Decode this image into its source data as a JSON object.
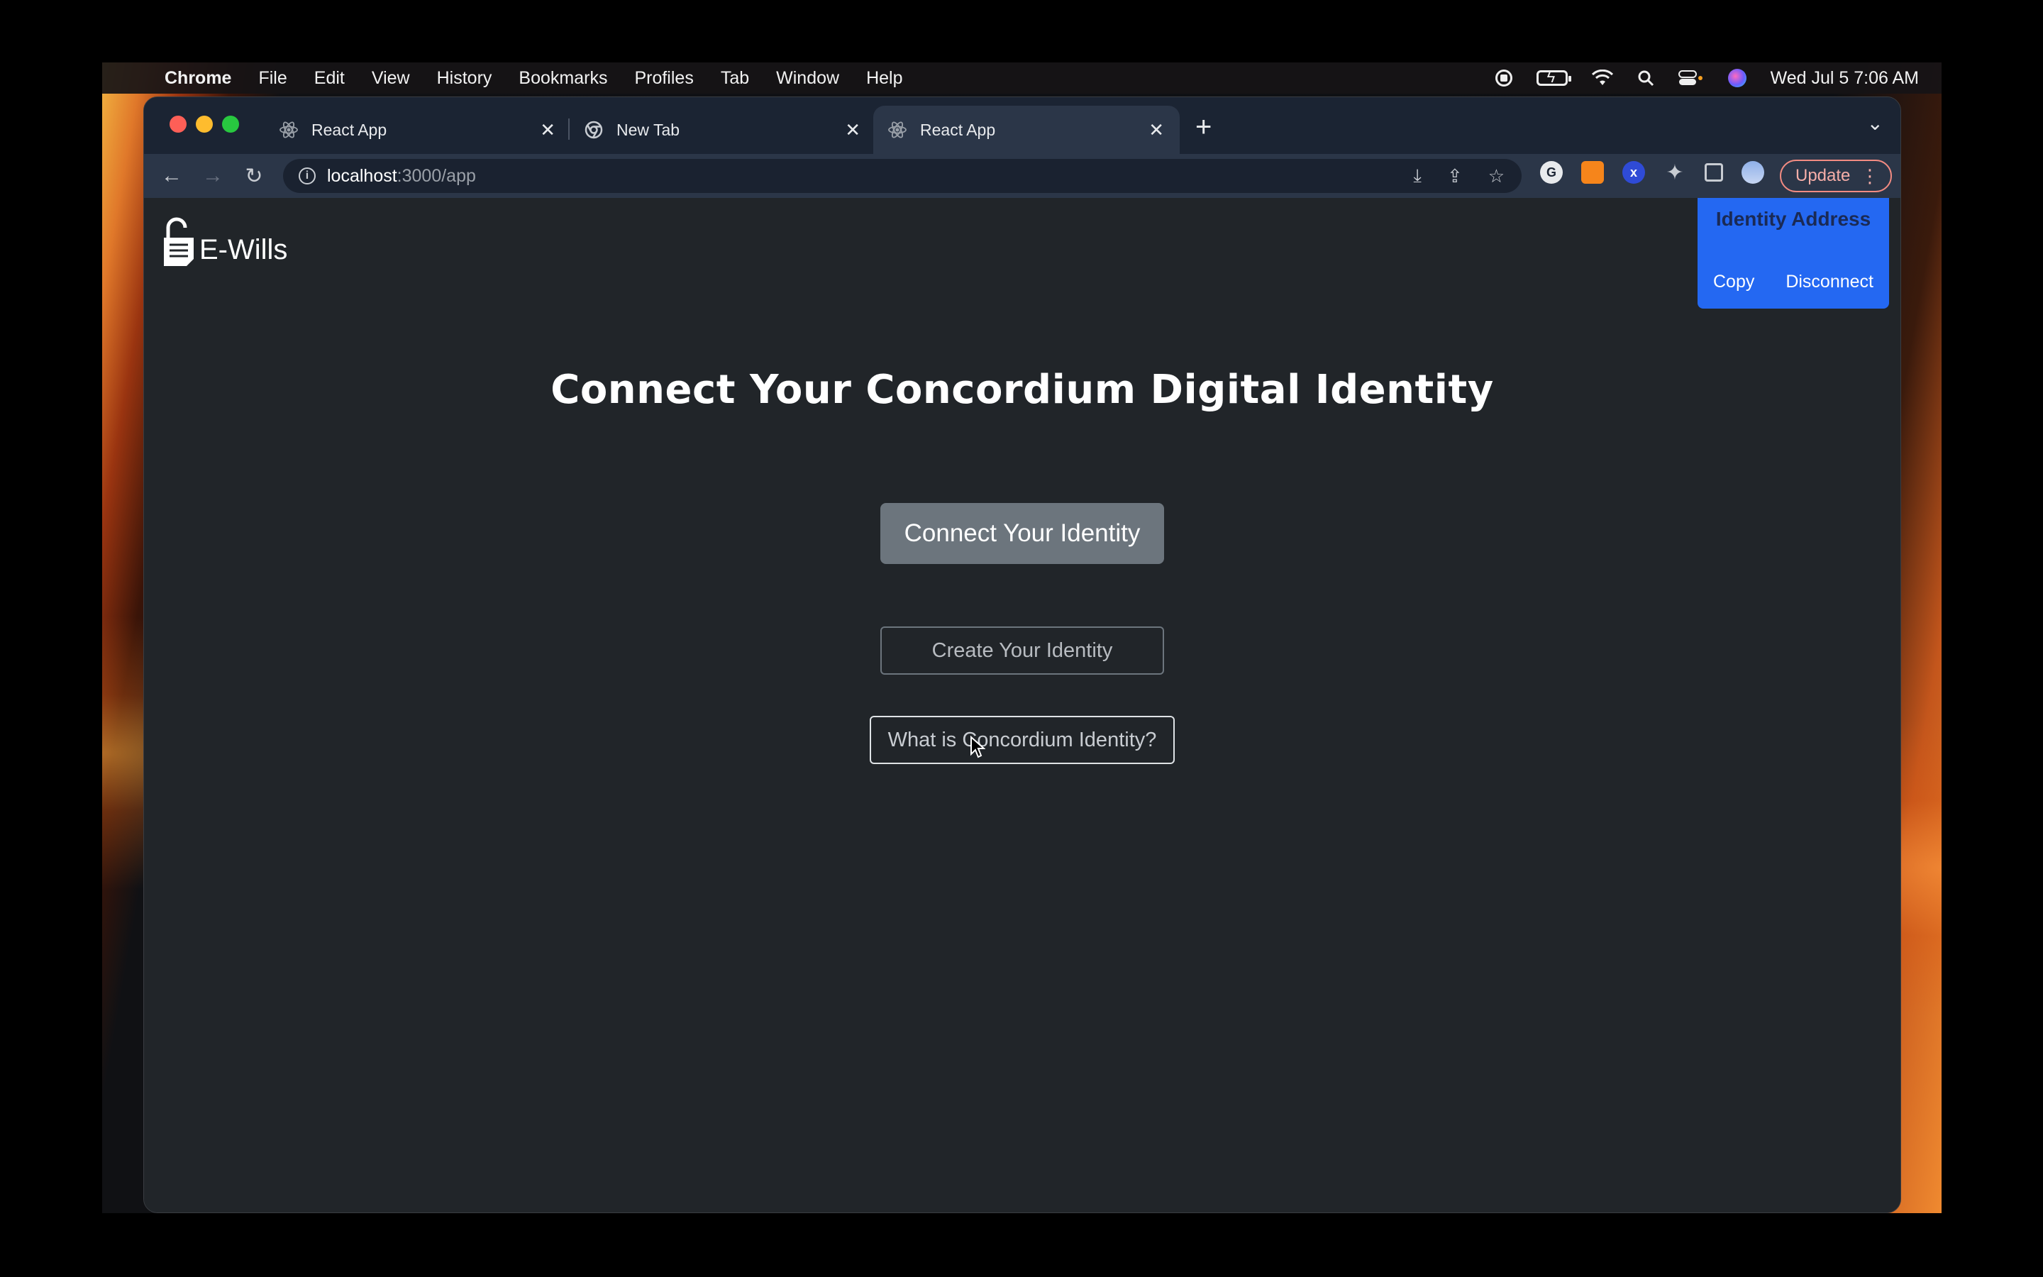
{
  "menubar": {
    "app_name": "Chrome",
    "items": [
      "File",
      "Edit",
      "View",
      "History",
      "Bookmarks",
      "Profiles",
      "Tab",
      "Window",
      "Help"
    ],
    "datetime": "Wed Jul 5  7:06 AM"
  },
  "browser": {
    "tabs": [
      {
        "title": "React App",
        "icon": "react-icon",
        "active": false
      },
      {
        "title": "New Tab",
        "icon": "chrome-icon",
        "active": false
      },
      {
        "title": "React App",
        "icon": "react-icon",
        "active": true
      }
    ],
    "url_host": "localhost",
    "url_path": ":3000/app",
    "update_label": "Update"
  },
  "page": {
    "brand": "E-Wills",
    "identity_panel": {
      "title": "Identity Address",
      "copy_label": "Copy",
      "disconnect_label": "Disconnect"
    },
    "headline": "Connect Your Concordium Digital Identity",
    "connect_button": "Connect Your Identity",
    "create_button": "Create Your Identity",
    "what_button": "What is Concordium Identity?"
  },
  "colors": {
    "page_bg": "#212529",
    "panel_accent": "#2468f2",
    "secondary_button": "#6c757d"
  }
}
